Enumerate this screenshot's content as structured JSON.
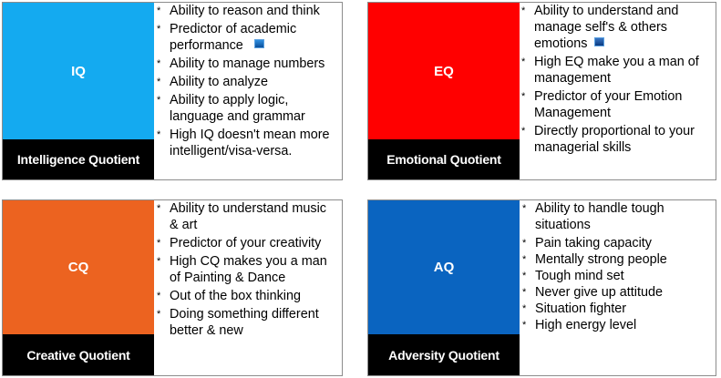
{
  "quadrants": {
    "iq": {
      "short": "IQ",
      "full": "Intelligence Quotient",
      "color": "#14aaf0",
      "items": [
        "Ability to reason and think",
        "Predictor of academic performance",
        "Ability to manage numbers",
        "Ability to analyze",
        "Ability to apply logic, language and grammar",
        "High IQ doesn't mean more intelligent/visa-versa."
      ]
    },
    "eq": {
      "short": "EQ",
      "full": "Emotional Quotient",
      "color": "#ff0000",
      "items": [
        "Ability to understand and manage self's & others emotions",
        "High EQ make you a man of management",
        "Predictor of your Emotion Management",
        "Directly proportional to your managerial skills"
      ]
    },
    "cq": {
      "short": "CQ",
      "full": "Creative Quotient",
      "color": "#ec6320",
      "items": [
        "Ability to understand music & art",
        "Predictor of your creativity",
        "High CQ makes you a man of Painting & Dance",
        "Out of the box thinking",
        "Doing something different better & new"
      ]
    },
    "aq": {
      "short": "AQ",
      "full": "Adversity Quotient",
      "color": "#0a64c0",
      "items": [
        "Ability to handle tough situations",
        "Pain taking capacity",
        "Mentally strong people",
        "Tough mind set",
        "Never give up attitude",
        "Situation fighter",
        "High energy level"
      ]
    }
  }
}
